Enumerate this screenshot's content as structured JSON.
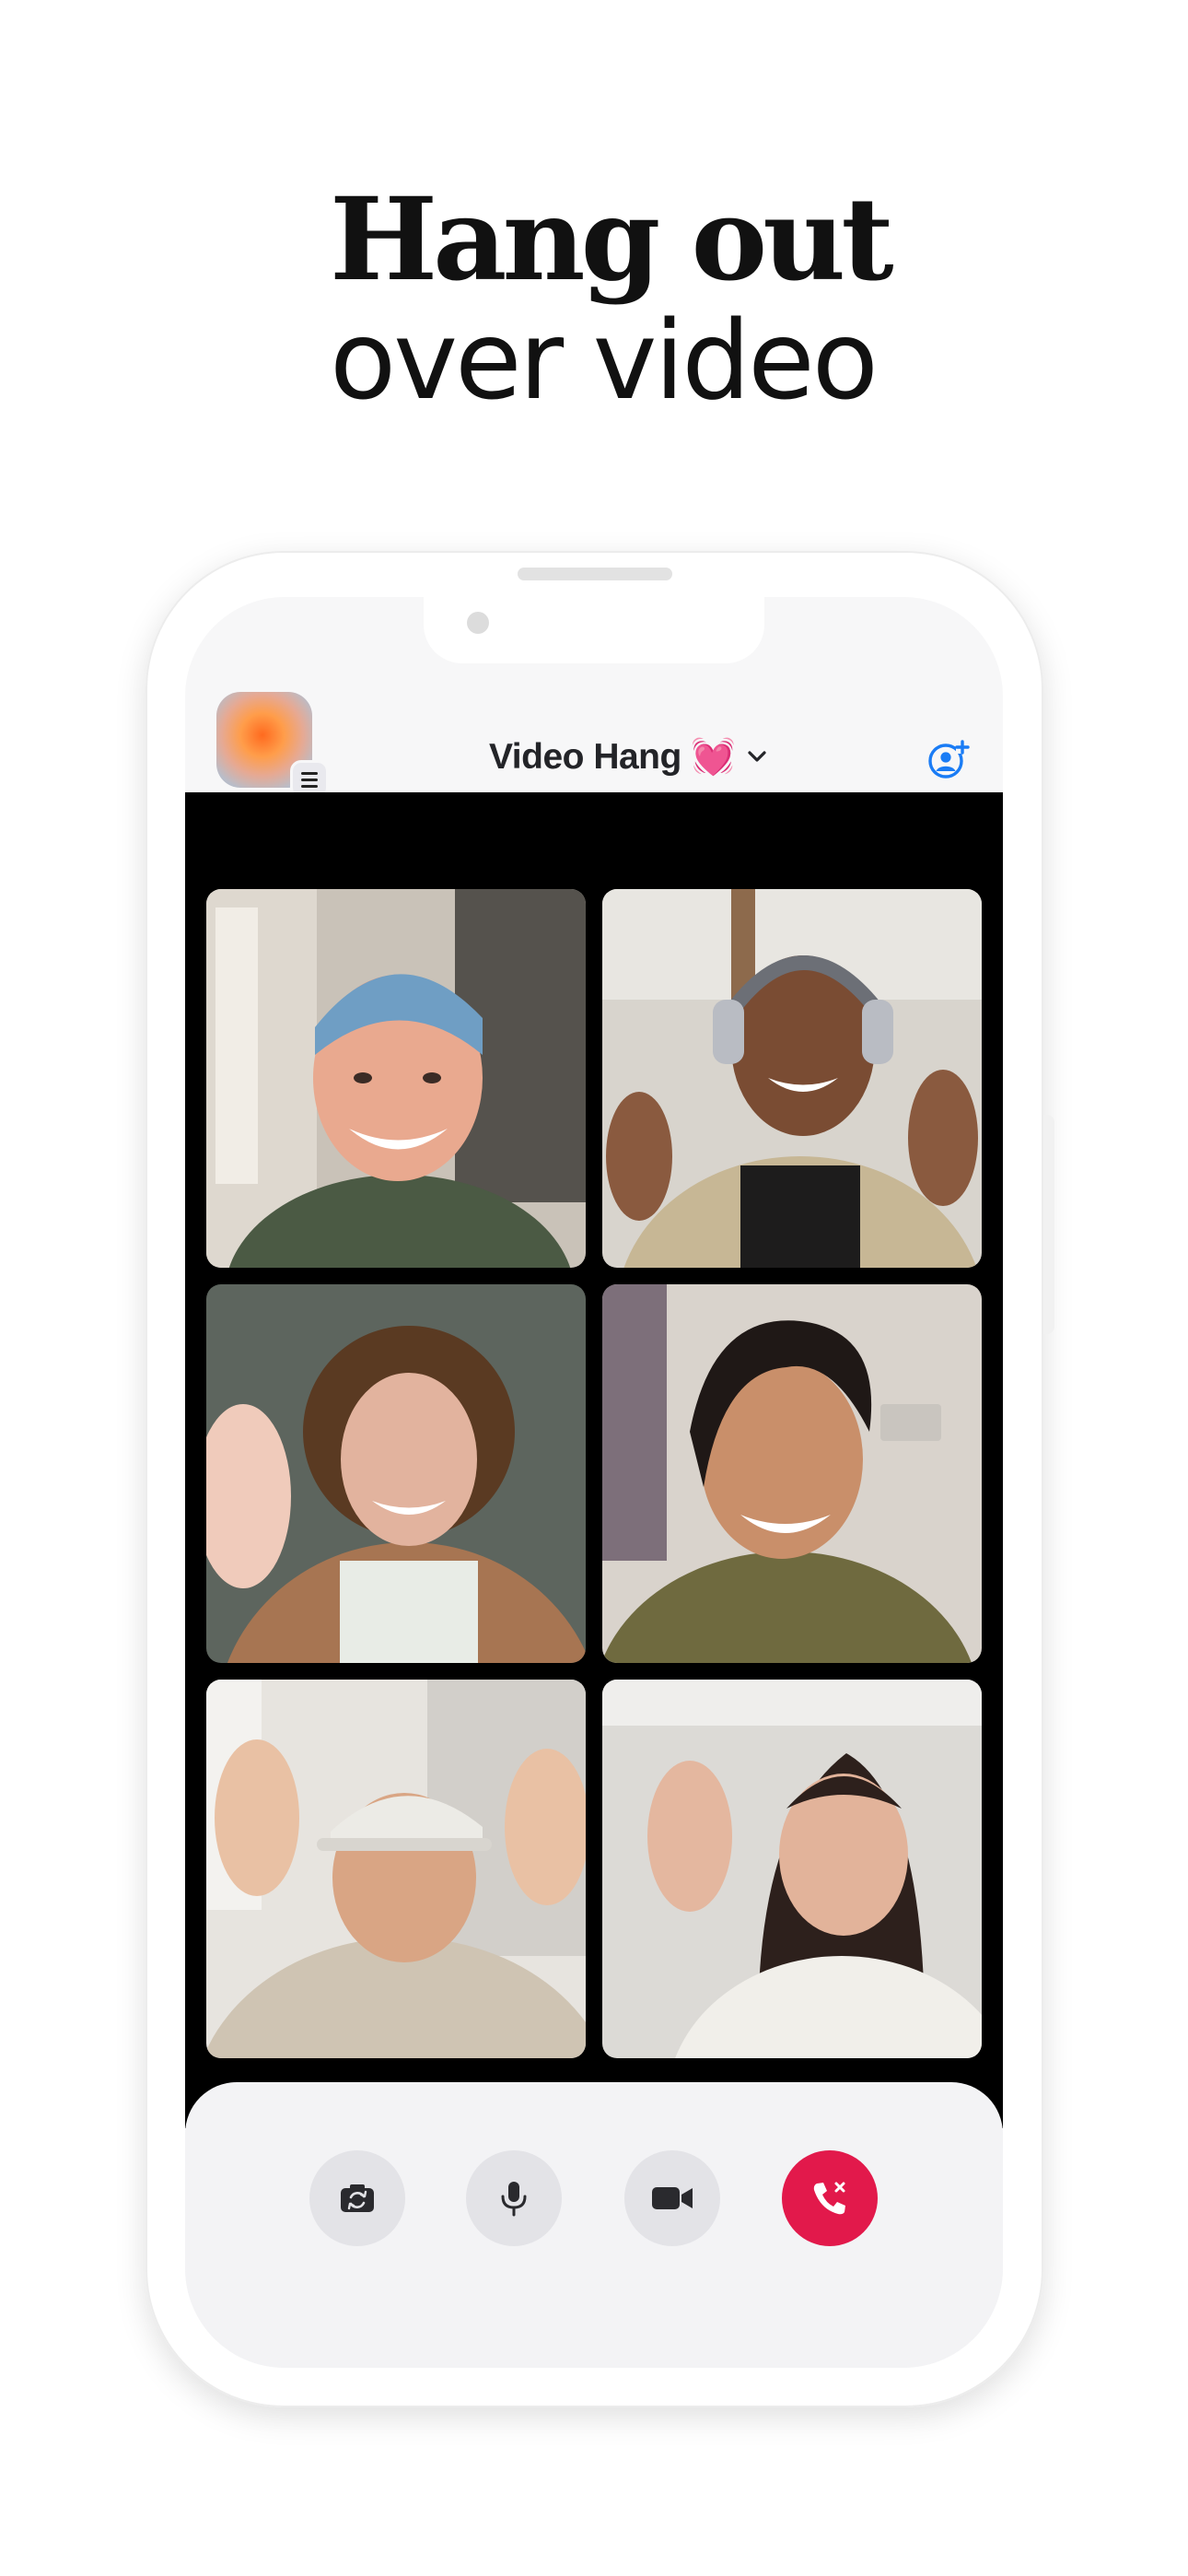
{
  "marketing": {
    "headline_line1": "Hang out",
    "headline_line2": "over video"
  },
  "app": {
    "header": {
      "title": "Video Hang 💓",
      "dropdown_icon": "chevron-down-icon",
      "add_person_icon": "person-add-icon",
      "menu_icon": "hamburger-icon"
    },
    "participants": [
      {
        "id": "p1"
      },
      {
        "id": "p2"
      },
      {
        "id": "p3"
      },
      {
        "id": "p4"
      },
      {
        "id": "p5"
      },
      {
        "id": "p6"
      }
    ],
    "controls": [
      {
        "id": "flip-camera",
        "icon": "camera-flip-icon"
      },
      {
        "id": "microphone",
        "icon": "microphone-icon"
      },
      {
        "id": "video",
        "icon": "video-camera-icon"
      },
      {
        "id": "end-call",
        "icon": "phone-hangup-icon"
      }
    ],
    "colors": {
      "accent_blue": "#1a7cf5",
      "end_call_red": "#e2194b",
      "video_background": "#000000"
    }
  }
}
